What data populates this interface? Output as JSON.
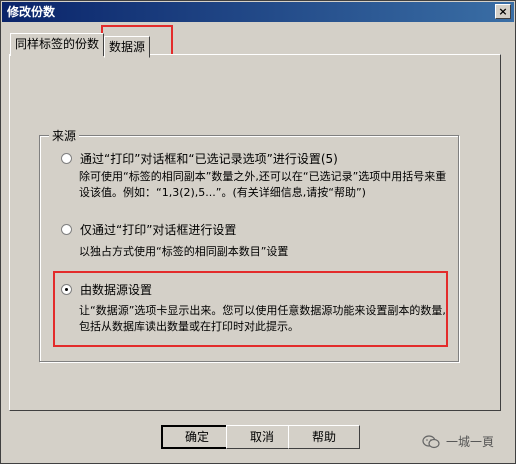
{
  "window": {
    "title": "修改份数",
    "close_glyph": "×"
  },
  "tabs": [
    {
      "label": "同样标签的份数"
    },
    {
      "label": "数据源"
    }
  ],
  "source_group": {
    "label": "来源",
    "options": [
      {
        "label": "通过“打印”对话框和“已选记录选项”进行设置(5)",
        "description": "除可使用“标签的相同副本”数量之外,还可以在“已选记录”选项中用括号来重设该值。例如：“1,3(2),5...”。(有关详细信息,请按“帮助”)",
        "checked": false
      },
      {
        "label": "仅通过“打印”对话框进行设置",
        "description": "以独占方式使用“标签的相同副本数目”设置",
        "checked": false
      },
      {
        "label": "由数据源设置",
        "description": "让“数据源”选项卡显示出来。您可以使用任意数据源功能来设置副本的数量,包括从数据库读出数量或在打印时对此提示。",
        "checked": true
      }
    ]
  },
  "buttons": {
    "ok": "确定",
    "cancel": "取消",
    "help": "帮助"
  },
  "watermark": {
    "text": "一城一頁",
    "icon": "wechat-icon"
  },
  "colors": {
    "highlight": "#e32b2b",
    "titlebar": "#0a246a"
  }
}
